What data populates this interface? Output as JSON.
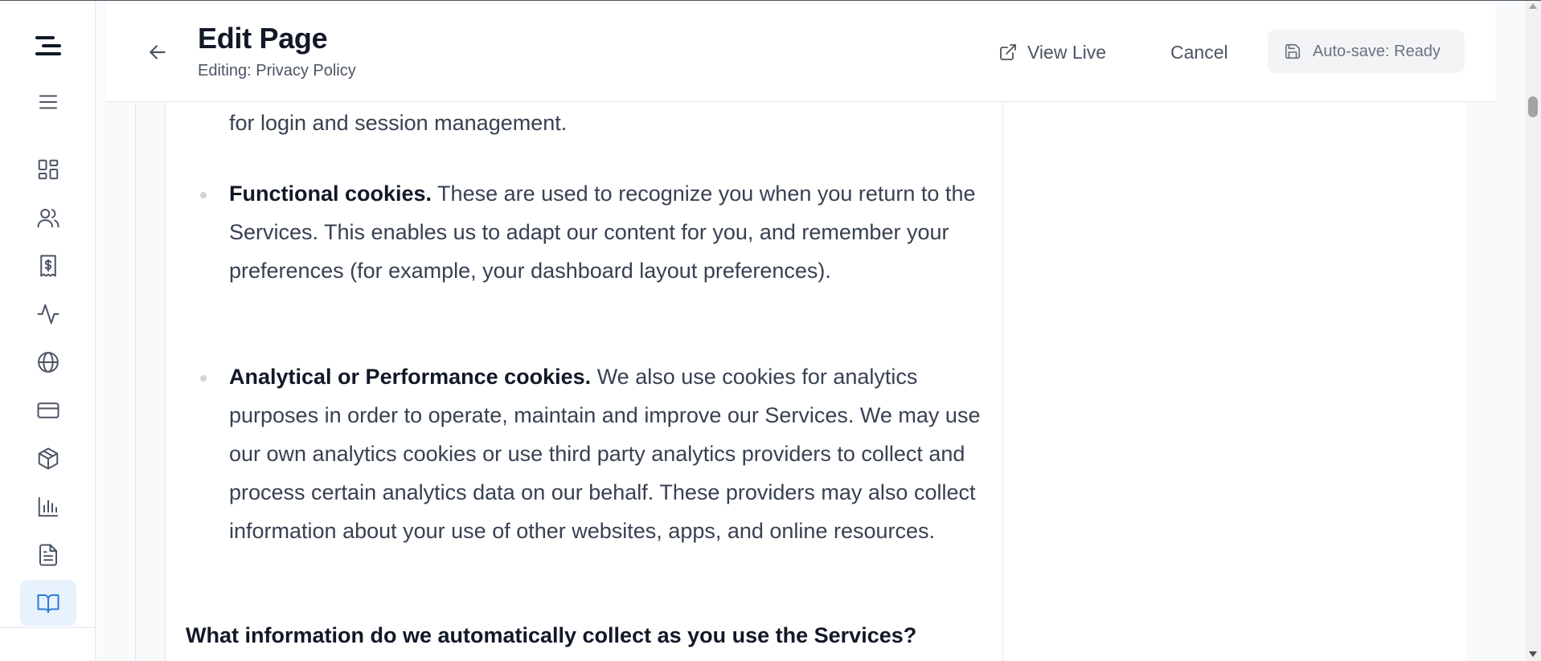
{
  "header": {
    "title": "Edit Page",
    "subtitle_prefix": "Editing: ",
    "subtitle_page": "Privacy Policy",
    "view_live_label": "View Live",
    "cancel_label": "Cancel",
    "autosave_label": "Auto-save: Ready"
  },
  "sidebar": {
    "items": [
      {
        "name": "menu",
        "icon": "menu-icon"
      },
      {
        "name": "dashboard",
        "icon": "dashboard-grid-icon"
      },
      {
        "name": "users",
        "icon": "users-icon"
      },
      {
        "name": "billing",
        "icon": "receipt-dollar-icon"
      },
      {
        "name": "activity",
        "icon": "activity-pulse-icon"
      },
      {
        "name": "domains",
        "icon": "globe-icon"
      },
      {
        "name": "payments",
        "icon": "credit-card-icon"
      },
      {
        "name": "products",
        "icon": "package-box-icon"
      },
      {
        "name": "analytics",
        "icon": "bar-chart-icon"
      },
      {
        "name": "documents",
        "icon": "document-icon"
      },
      {
        "name": "pages",
        "icon": "book-open-icon",
        "active": true
      }
    ]
  },
  "document": {
    "fragment_text": "for login and session management.",
    "bullets": [
      {
        "bold": "Functional cookies.",
        "text": " These are used to recognize you when you return to the Services. This enables us to adapt our content for you, and remember your preferences (for example, your dashboard layout preferences)."
      },
      {
        "bold": "Analytical or Performance cookies.",
        "text": " We also use cookies for analytics purposes in order to operate, maintain and improve our Services. We may use our own analytics cookies or use third party analytics providers to collect and process certain analytics data on our behalf. These providers may also collect information about your use of other websites, apps, and online resources."
      }
    ],
    "heading": "What information do we automatically collect as you use the Services?"
  },
  "colors": {
    "active_nav_bg": "#e8f2fd",
    "active_nav_icon": "#2b7bd6",
    "icon_default": "#4b5563"
  }
}
